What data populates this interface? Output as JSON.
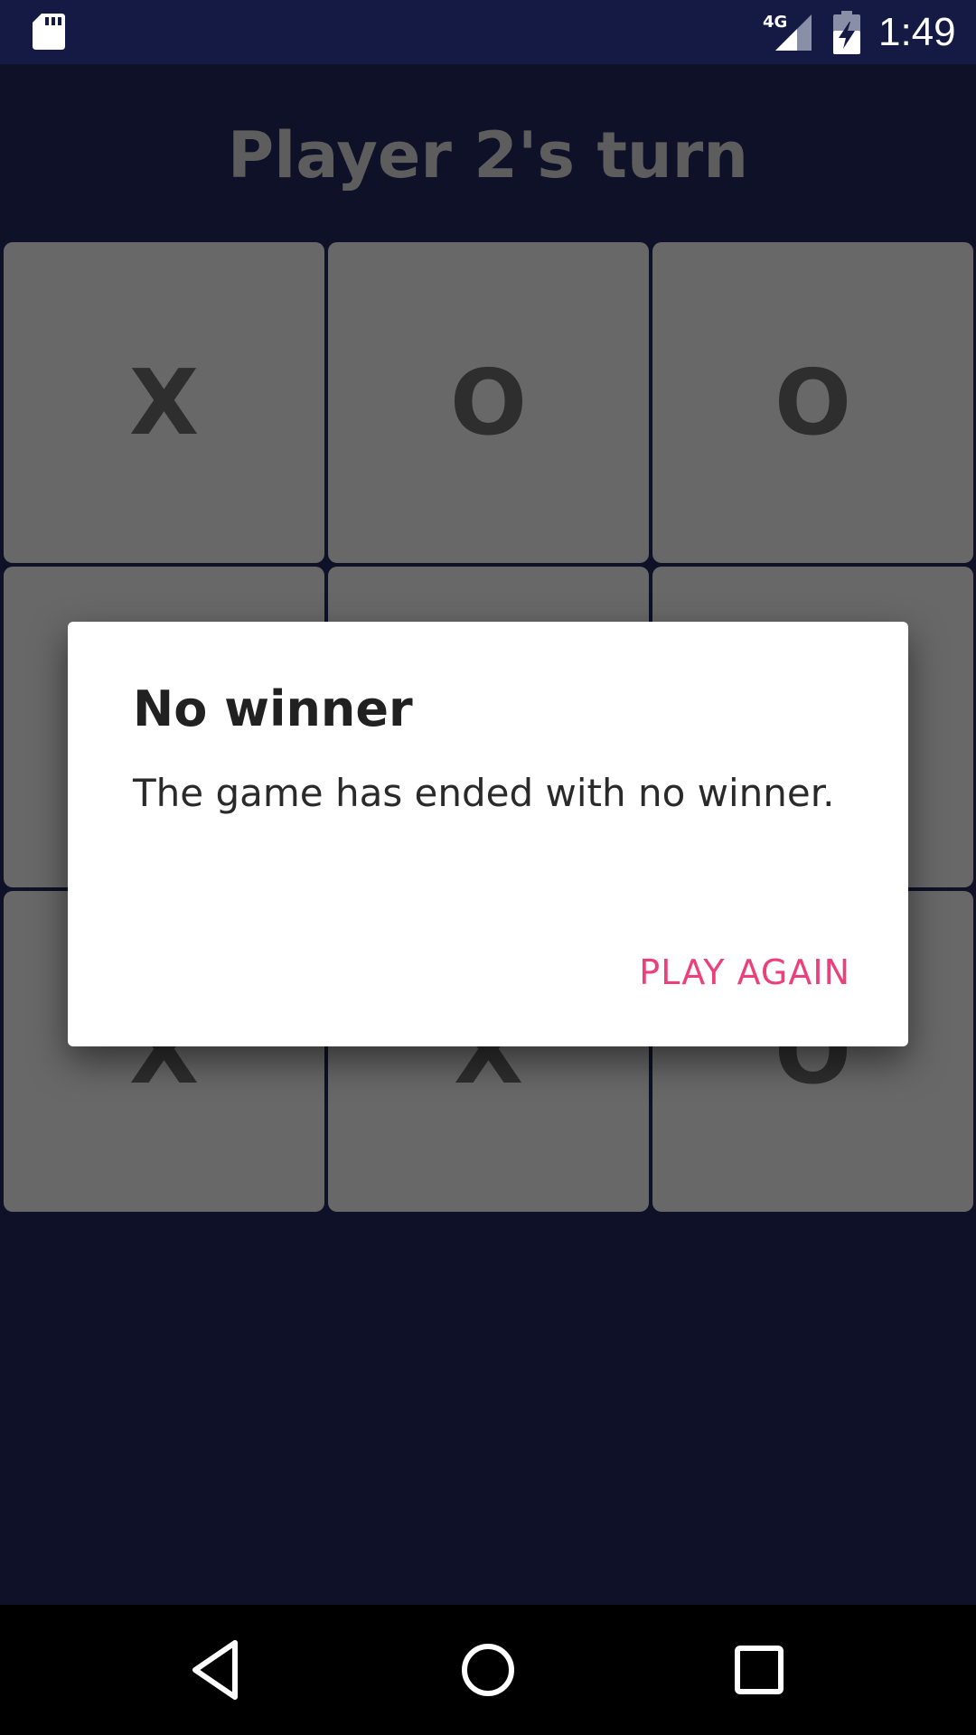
{
  "status_bar": {
    "time": "1:49",
    "network_label": "4G",
    "icons": [
      "sd-card-icon",
      "signal-icon",
      "battery-charging-icon"
    ]
  },
  "app": {
    "turn_title": "Player 2's turn",
    "board": [
      [
        "X",
        "O",
        "O"
      ],
      [
        "",
        "",
        ""
      ],
      [
        "X",
        "X",
        "O"
      ]
    ]
  },
  "dialog": {
    "title": "No winner",
    "message": "The game has ended with no winner.",
    "positive_button": "PLAY AGAIN",
    "accent_color": "#ec407a"
  },
  "nav_bar": {
    "icons": [
      "back-icon",
      "home-icon",
      "recents-icon"
    ]
  }
}
